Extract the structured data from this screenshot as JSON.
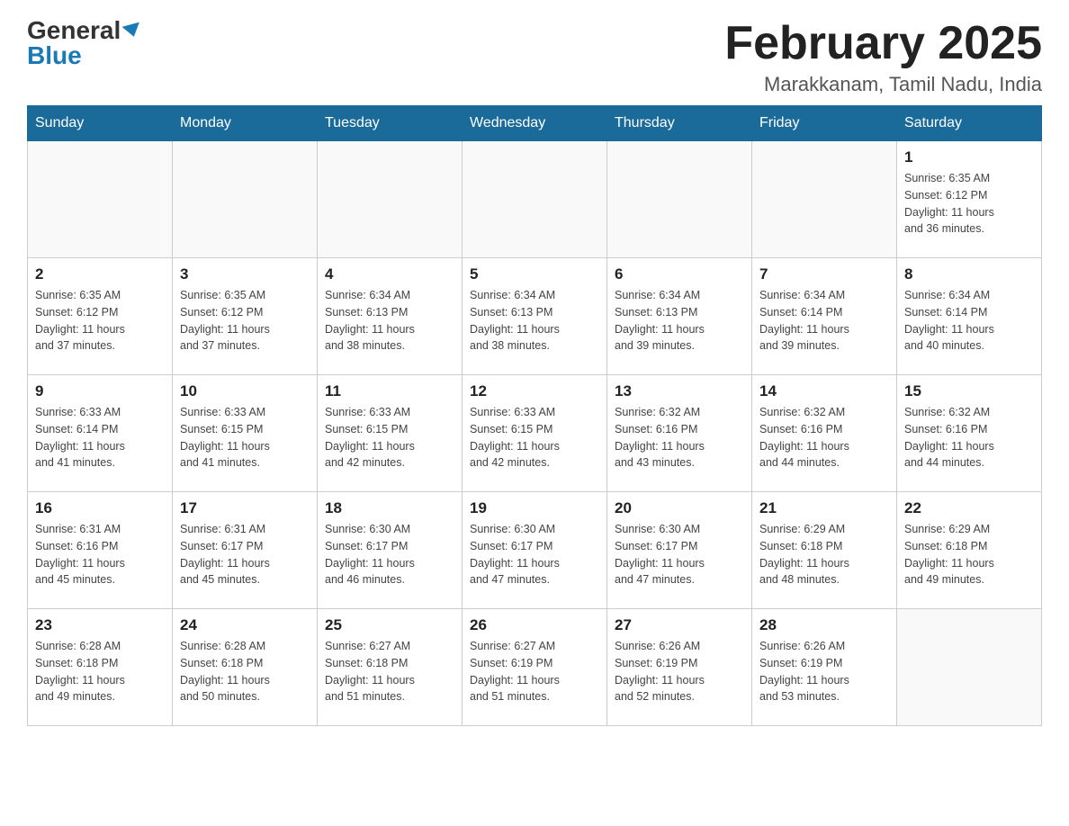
{
  "logo": {
    "general": "General",
    "blue": "Blue"
  },
  "title": "February 2025",
  "location": "Marakkanam, Tamil Nadu, India",
  "days_of_week": [
    "Sunday",
    "Monday",
    "Tuesday",
    "Wednesday",
    "Thursday",
    "Friday",
    "Saturday"
  ],
  "weeks": [
    [
      {
        "day": "",
        "info": ""
      },
      {
        "day": "",
        "info": ""
      },
      {
        "day": "",
        "info": ""
      },
      {
        "day": "",
        "info": ""
      },
      {
        "day": "",
        "info": ""
      },
      {
        "day": "",
        "info": ""
      },
      {
        "day": "1",
        "info": "Sunrise: 6:35 AM\nSunset: 6:12 PM\nDaylight: 11 hours\nand 36 minutes."
      }
    ],
    [
      {
        "day": "2",
        "info": "Sunrise: 6:35 AM\nSunset: 6:12 PM\nDaylight: 11 hours\nand 37 minutes."
      },
      {
        "day": "3",
        "info": "Sunrise: 6:35 AM\nSunset: 6:12 PM\nDaylight: 11 hours\nand 37 minutes."
      },
      {
        "day": "4",
        "info": "Sunrise: 6:34 AM\nSunset: 6:13 PM\nDaylight: 11 hours\nand 38 minutes."
      },
      {
        "day": "5",
        "info": "Sunrise: 6:34 AM\nSunset: 6:13 PM\nDaylight: 11 hours\nand 38 minutes."
      },
      {
        "day": "6",
        "info": "Sunrise: 6:34 AM\nSunset: 6:13 PM\nDaylight: 11 hours\nand 39 minutes."
      },
      {
        "day": "7",
        "info": "Sunrise: 6:34 AM\nSunset: 6:14 PM\nDaylight: 11 hours\nand 39 minutes."
      },
      {
        "day": "8",
        "info": "Sunrise: 6:34 AM\nSunset: 6:14 PM\nDaylight: 11 hours\nand 40 minutes."
      }
    ],
    [
      {
        "day": "9",
        "info": "Sunrise: 6:33 AM\nSunset: 6:14 PM\nDaylight: 11 hours\nand 41 minutes."
      },
      {
        "day": "10",
        "info": "Sunrise: 6:33 AM\nSunset: 6:15 PM\nDaylight: 11 hours\nand 41 minutes."
      },
      {
        "day": "11",
        "info": "Sunrise: 6:33 AM\nSunset: 6:15 PM\nDaylight: 11 hours\nand 42 minutes."
      },
      {
        "day": "12",
        "info": "Sunrise: 6:33 AM\nSunset: 6:15 PM\nDaylight: 11 hours\nand 42 minutes."
      },
      {
        "day": "13",
        "info": "Sunrise: 6:32 AM\nSunset: 6:16 PM\nDaylight: 11 hours\nand 43 minutes."
      },
      {
        "day": "14",
        "info": "Sunrise: 6:32 AM\nSunset: 6:16 PM\nDaylight: 11 hours\nand 44 minutes."
      },
      {
        "day": "15",
        "info": "Sunrise: 6:32 AM\nSunset: 6:16 PM\nDaylight: 11 hours\nand 44 minutes."
      }
    ],
    [
      {
        "day": "16",
        "info": "Sunrise: 6:31 AM\nSunset: 6:16 PM\nDaylight: 11 hours\nand 45 minutes."
      },
      {
        "day": "17",
        "info": "Sunrise: 6:31 AM\nSunset: 6:17 PM\nDaylight: 11 hours\nand 45 minutes."
      },
      {
        "day": "18",
        "info": "Sunrise: 6:30 AM\nSunset: 6:17 PM\nDaylight: 11 hours\nand 46 minutes."
      },
      {
        "day": "19",
        "info": "Sunrise: 6:30 AM\nSunset: 6:17 PM\nDaylight: 11 hours\nand 47 minutes."
      },
      {
        "day": "20",
        "info": "Sunrise: 6:30 AM\nSunset: 6:17 PM\nDaylight: 11 hours\nand 47 minutes."
      },
      {
        "day": "21",
        "info": "Sunrise: 6:29 AM\nSunset: 6:18 PM\nDaylight: 11 hours\nand 48 minutes."
      },
      {
        "day": "22",
        "info": "Sunrise: 6:29 AM\nSunset: 6:18 PM\nDaylight: 11 hours\nand 49 minutes."
      }
    ],
    [
      {
        "day": "23",
        "info": "Sunrise: 6:28 AM\nSunset: 6:18 PM\nDaylight: 11 hours\nand 49 minutes."
      },
      {
        "day": "24",
        "info": "Sunrise: 6:28 AM\nSunset: 6:18 PM\nDaylight: 11 hours\nand 50 minutes."
      },
      {
        "day": "25",
        "info": "Sunrise: 6:27 AM\nSunset: 6:18 PM\nDaylight: 11 hours\nand 51 minutes."
      },
      {
        "day": "26",
        "info": "Sunrise: 6:27 AM\nSunset: 6:19 PM\nDaylight: 11 hours\nand 51 minutes."
      },
      {
        "day": "27",
        "info": "Sunrise: 6:26 AM\nSunset: 6:19 PM\nDaylight: 11 hours\nand 52 minutes."
      },
      {
        "day": "28",
        "info": "Sunrise: 6:26 AM\nSunset: 6:19 PM\nDaylight: 11 hours\nand 53 minutes."
      },
      {
        "day": "",
        "info": ""
      }
    ]
  ]
}
